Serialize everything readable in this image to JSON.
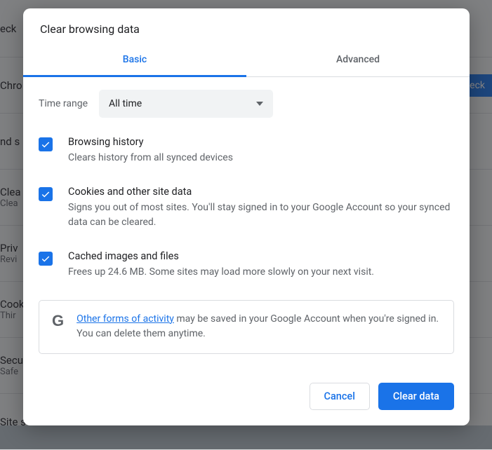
{
  "background": {
    "items": [
      "eck",
      "Chro",
      "nd s",
      "Clea",
      "Clea",
      "Priv",
      "Revi",
      "Cook",
      "Thir",
      "Secu",
      "Safe",
      "Site s"
    ],
    "chip": "eck"
  },
  "modal": {
    "title": "Clear browsing data",
    "tabs": {
      "basic": "Basic",
      "advanced": "Advanced"
    },
    "time_range": {
      "label": "Time range",
      "value": "All time"
    },
    "options": [
      {
        "title": "Browsing history",
        "desc": "Clears history from all synced devices"
      },
      {
        "title": "Cookies and other site data",
        "desc": "Signs you out of most sites. You'll stay signed in to your Google Account so your synced data can be cleared."
      },
      {
        "title": "Cached images and files",
        "desc": "Frees up 24.6 MB. Some sites may load more slowly on your next visit."
      }
    ],
    "notice": {
      "link_text": "Other forms of activity",
      "rest": " may be saved in your Google Account when you're signed in. You can delete them anytime."
    },
    "buttons": {
      "cancel": "Cancel",
      "clear": "Clear data"
    }
  }
}
